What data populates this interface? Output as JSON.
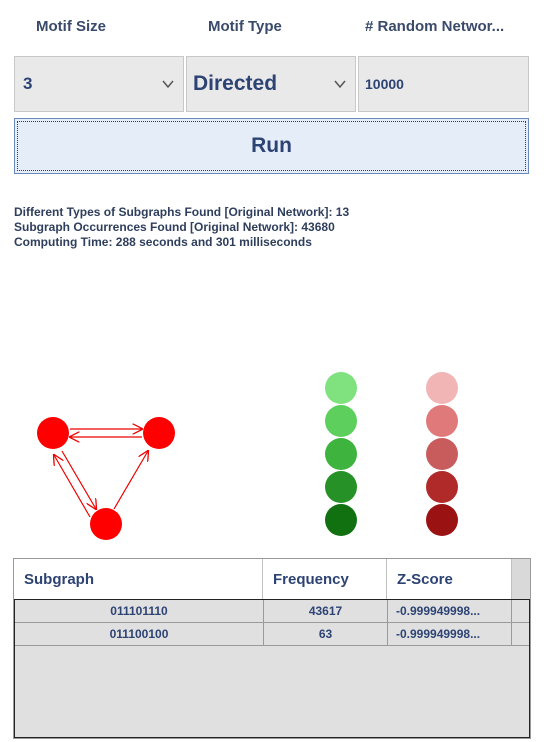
{
  "headers": {
    "motif_size": "Motif Size",
    "motif_type": "Motif Type",
    "random_networks": "# Random Networ..."
  },
  "controls": {
    "motif_size_value": "3",
    "motif_type_value": "Directed",
    "random_networks_value": "10000",
    "run_label": "Run"
  },
  "stats": {
    "line1": "Different Types of Subgraphs Found [Original Network]: 13",
    "line2": "Subgraph Occurrences Found [Original Network]: 43680",
    "line3": "Computing Time: 288 seconds and 301 milliseconds"
  },
  "legend": {
    "green": [
      "#7fe27f",
      "#5ccf5c",
      "#3eb33e",
      "#269126",
      "#117111"
    ],
    "red": [
      "#f2b5b5",
      "#e07a7a",
      "#c85c5c",
      "#b02a2a",
      "#9a1212"
    ]
  },
  "table": {
    "columns": [
      "Subgraph",
      "Frequency",
      "Z-Score"
    ],
    "rows": [
      {
        "subgraph": "011101110",
        "frequency": "43617",
        "zscore": "-0.999949998..."
      },
      {
        "subgraph": "011100100",
        "frequency": "63",
        "zscore": "-0.999949998..."
      }
    ]
  }
}
